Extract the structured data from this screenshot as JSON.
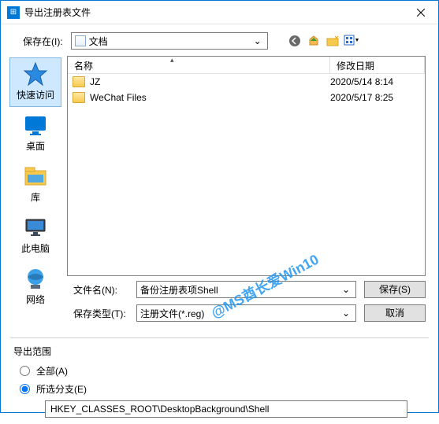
{
  "title": "导出注册表文件",
  "savein_label": "保存在(I):",
  "savein_value": "文档",
  "places": {
    "quick": "快速访问",
    "desktop": "桌面",
    "library": "库",
    "thispc": "此电脑",
    "network": "网络"
  },
  "columns": {
    "name": "名称",
    "date": "修改日期"
  },
  "files": [
    {
      "name": "JZ",
      "date": "2020/5/14 8:14"
    },
    {
      "name": "WeChat Files",
      "date": "2020/5/17 8:25"
    }
  ],
  "filename_label": "文件名(N):",
  "filename_value": "备份注册表项Shell",
  "filetype_label": "保存类型(T):",
  "filetype_value": "注册文件(*.reg)",
  "save_btn": "保存(S)",
  "cancel_btn": "取消",
  "export_group": "导出范围",
  "radio_all": "全部(A)",
  "radio_branch": "所选分支(E)",
  "branch_value": "HKEY_CLASSES_ROOT\\DesktopBackground\\Shell",
  "watermark": "@MS酋长爱Win10"
}
